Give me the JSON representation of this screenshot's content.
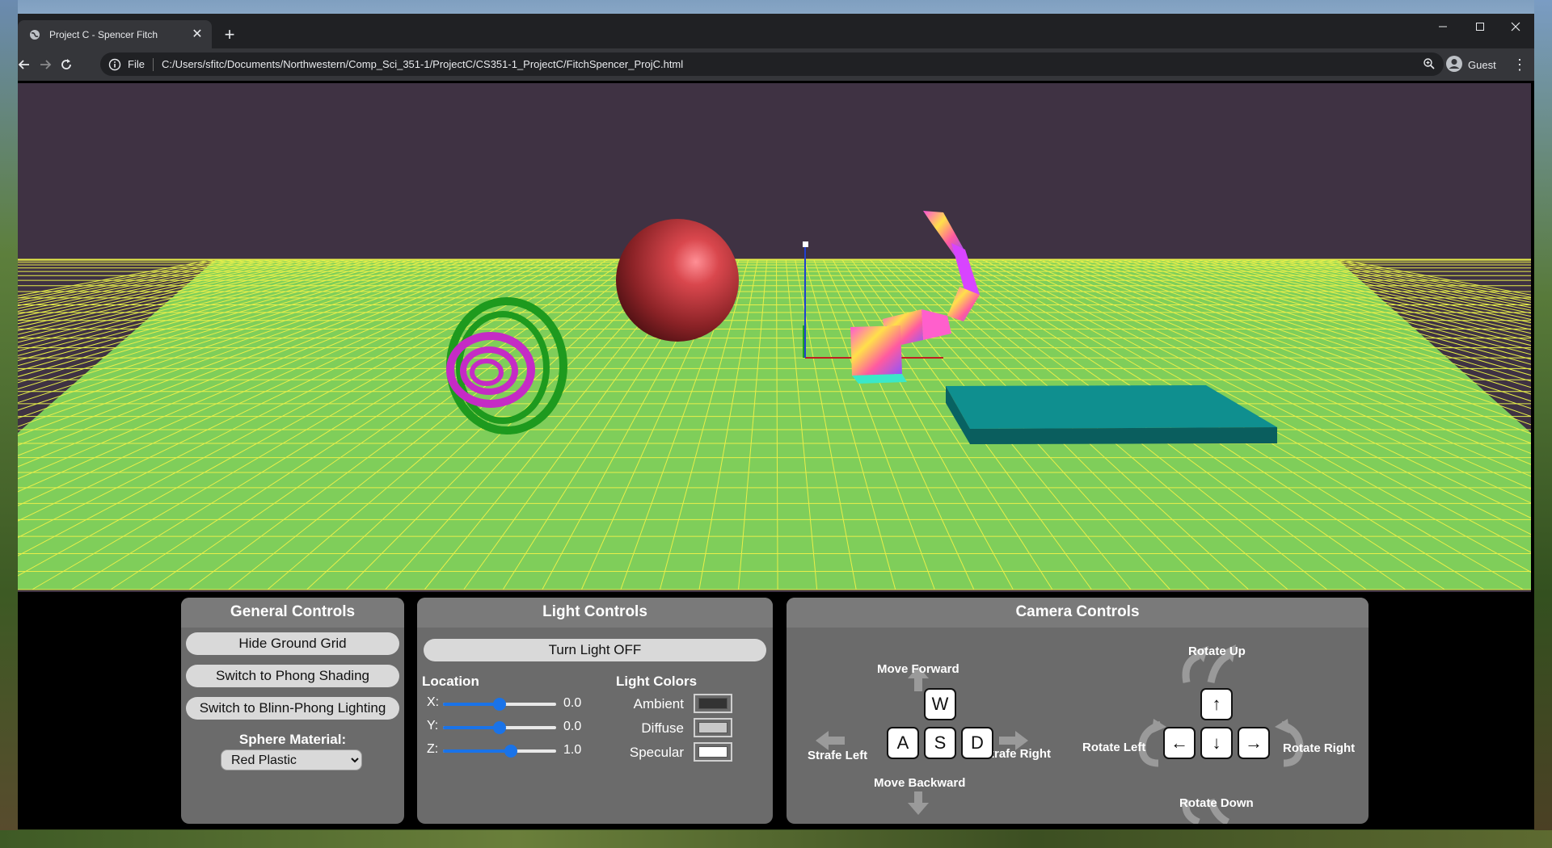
{
  "browser": {
    "tab_title": "Project C - Spencer Fitch",
    "new_tab_symbol": "+",
    "close_symbol": "✕",
    "scheme_label": "File",
    "url": "C:/Users/sfitc/Documents/Northwestern/Comp_Sci_351-1/ProjectC/CS351-1_ProjectC/FitchSpencer_ProjC.html",
    "profile_label": "Guest"
  },
  "general_controls": {
    "title": "General Controls",
    "hide_grid_label": "Hide Ground Grid",
    "shading_label": "Switch to Phong Shading",
    "lighting_label": "Switch to Blinn-Phong Lighting",
    "material_label": "Sphere Material:",
    "material_selected": "Red Plastic"
  },
  "light_controls": {
    "title": "Light Controls",
    "toggle_label": "Turn Light OFF",
    "location_label": "Location",
    "sliders": [
      {
        "label": "X:",
        "value": "0.0",
        "position": 0.5
      },
      {
        "label": "Y:",
        "value": "0.0",
        "position": 0.5
      },
      {
        "label": "Z:",
        "value": "1.0",
        "position": 0.6
      }
    ],
    "colors_label": "Light Colors",
    "colors": [
      {
        "label": "Ambient",
        "color": "#333333"
      },
      {
        "label": "Diffuse",
        "color": "#c8c8c8"
      },
      {
        "label": "Specular",
        "color": "#ffffff"
      }
    ]
  },
  "camera_controls": {
    "title": "Camera Controls",
    "move_forward": "Move Forward",
    "move_backward": "Move Backward",
    "strafe_left": "Strafe Left",
    "strafe_right": "Strafe Right",
    "rotate_up": "Rotate Up",
    "rotate_down": "Rotate Down",
    "rotate_left": "Rotate Left",
    "rotate_right": "Rotate Right",
    "keys": {
      "w": "W",
      "a": "A",
      "s": "S",
      "d": "D",
      "up": "↑",
      "down": "↓",
      "left": "←",
      "right": "→"
    }
  },
  "colors": {
    "sky": "#3f3243",
    "ground": "#7fce5a",
    "grid_line": "#e8ef4a",
    "sphere": "#c0393f",
    "teal_box": "#0f8f8f",
    "gimbal_green": "#1e9a1e",
    "gimbal_magenta": "#c52bc5"
  }
}
